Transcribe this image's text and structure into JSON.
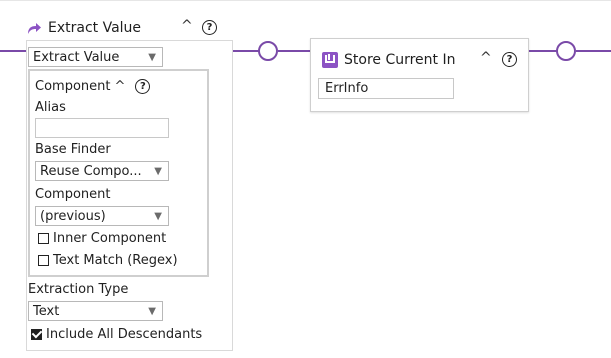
{
  "extract_value": {
    "title": "Extract Value",
    "action_select": "Extract Value",
    "component": {
      "title": "Component",
      "alias_label": "Alias",
      "alias_value": "",
      "base_finder_label": "Base Finder",
      "base_finder_value": "Reuse Compo...",
      "component_label": "Component",
      "component_value": "(previous)",
      "inner_component_label": "Inner Component",
      "text_match_label": "Text Match (Regex)"
    },
    "extraction_type_label": "Extraction Type",
    "extraction_type_value": "Text",
    "include_all_descendants_label": "Include All Descendants",
    "include_all_descendants_checked": true
  },
  "store_current_in": {
    "title": "Store Current In",
    "value": "ErrInfo"
  },
  "icons": {
    "extract": "curved-arrow-icon",
    "store": "download-tray-icon",
    "help": "help-circle-icon",
    "collapse": "chevron-up-icon",
    "dropdown": "triangle-down-icon"
  },
  "colors": {
    "connector": "#7a4aa8",
    "accent": "#8c53c4"
  }
}
